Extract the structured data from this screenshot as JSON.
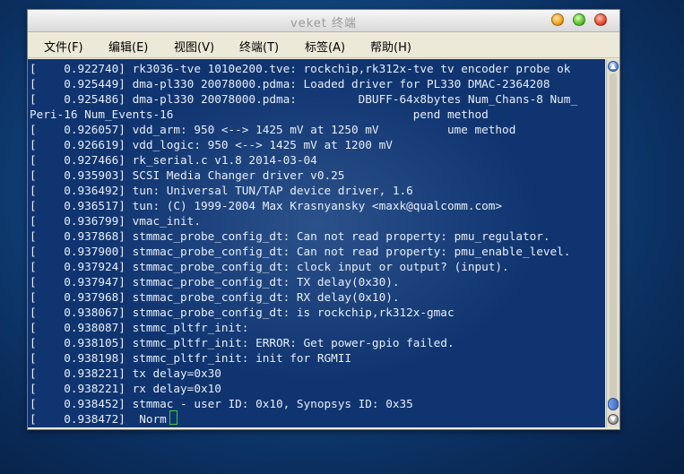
{
  "window": {
    "title": "veket 终端"
  },
  "menu": [
    {
      "label": "文件(F)"
    },
    {
      "label": "编辑(E)"
    },
    {
      "label": "视图(V)"
    },
    {
      "label": "终端(T)"
    },
    {
      "label": "标签(A)"
    },
    {
      "label": "帮助(H)"
    }
  ],
  "terminal": {
    "lines": [
      "[    0.922740] rk3036-tve 1010e200.tve: rockchip,rk312x-tve tv encoder probe ok",
      "[    0.925449] dma-pl330 20078000.pdma: Loaded driver for PL330 DMAC-2364208",
      "[    0.925486] dma-pl330 20078000.pdma:         DBUFF-64x8bytes Num_Chans-8 Num_",
      "Peri-16 Num_Events-16                                   pend method",
      "[    0.926057] vdd_arm: 950 <--> 1425 mV at 1250 mV          ume method",
      "[    0.926619] vdd_logic: 950 <--> 1425 mV at 1200 mV",
      "[    0.927466] rk_serial.c v1.8 2014-03-04",
      "[    0.935903] SCSI Media Changer driver v0.25",
      "[    0.936492] tun: Universal TUN/TAP device driver, 1.6",
      "[    0.936517] tun: (C) 1999-2004 Max Krasnyansky <maxk@qualcomm.com>",
      "[    0.936799] vmac_init.",
      "[    0.937868] stmmac_probe_config_dt: Can not read property: pmu_regulator.",
      "[    0.937900] stmmac_probe_config_dt: Can not read property: pmu_enable_level.",
      "[    0.937924] stmmac_probe_config_dt: clock input or output? (input).",
      "[    0.937947] stmmac_probe_config_dt: TX delay(0x30).",
      "[    0.937968] stmmac_probe_config_dt: RX delay(0x10).",
      "[    0.938067] stmmac_probe_config_dt: is rockchip,rk312x-gmac",
      "[    0.938087] stmmc_pltfr_init:",
      "[    0.938105] stmmc_pltfr_init: ERROR: Get power-gpio failed.",
      "[    0.938198] stmmc_pltfr_init: init for RGMII",
      "[    0.938221] tx delay=0x30",
      "[    0.938221] rx delay=0x10",
      "[    0.938452] stmmac - user ID: 0x10, Synopsys ID: 0x35",
      "[    0.938472]  Norm"
    ]
  },
  "colors": {
    "terminal_text": "#e8eef8",
    "cursor": "#3ad03a",
    "menubar": "#ece9d8"
  }
}
